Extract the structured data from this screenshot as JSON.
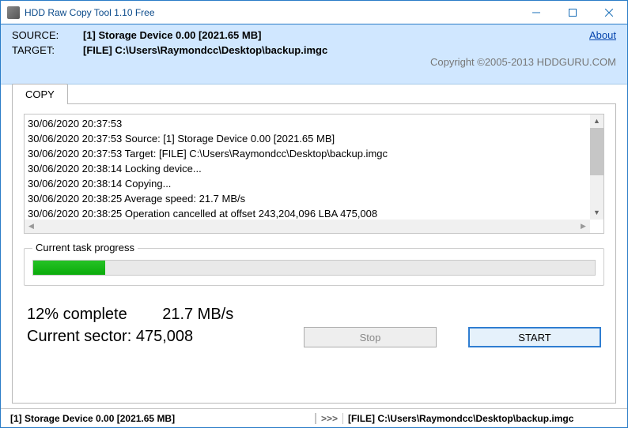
{
  "window": {
    "title": "HDD Raw Copy Tool 1.10   Free"
  },
  "header": {
    "source_label": "SOURCE:",
    "source_value": "[1]  Storage Device   0.00   [2021.65 MB]",
    "target_label": "TARGET:",
    "target_value": "[FILE] C:\\Users\\Raymondcc\\Desktop\\backup.imgc",
    "about": "About",
    "copyright": "Copyright ©2005-2013 HDDGURU.COM"
  },
  "tab": {
    "label": "COPY"
  },
  "log": [
    "30/06/2020 20:37:53",
    "30/06/2020 20:37:53   Source: [1]  Storage Device   0.00   [2021.65 MB]",
    "30/06/2020 20:37:53   Target: [FILE] C:\\Users\\Raymondcc\\Desktop\\backup.imgc",
    "30/06/2020 20:38:14   Locking device...",
    "30/06/2020 20:38:14   Copying...",
    "30/06/2020 20:38:25   Average speed: 21.7 MB/s",
    "30/06/2020 20:38:25   Operation cancelled at offset 243,204,096   LBA 475,008"
  ],
  "progress": {
    "legend": "Current task progress"
  },
  "stats": {
    "line1_a": "12% complete",
    "line1_b": "21.7 MB/s",
    "line2": "Current sector: 475,008"
  },
  "buttons": {
    "stop": "Stop",
    "start": "START"
  },
  "statusbar": {
    "source": "[1]  Storage Device   0.00   [2021.65 MB]",
    "sep": ">>>",
    "target": "[FILE] C:\\Users\\Raymondcc\\Desktop\\backup.imgc"
  }
}
